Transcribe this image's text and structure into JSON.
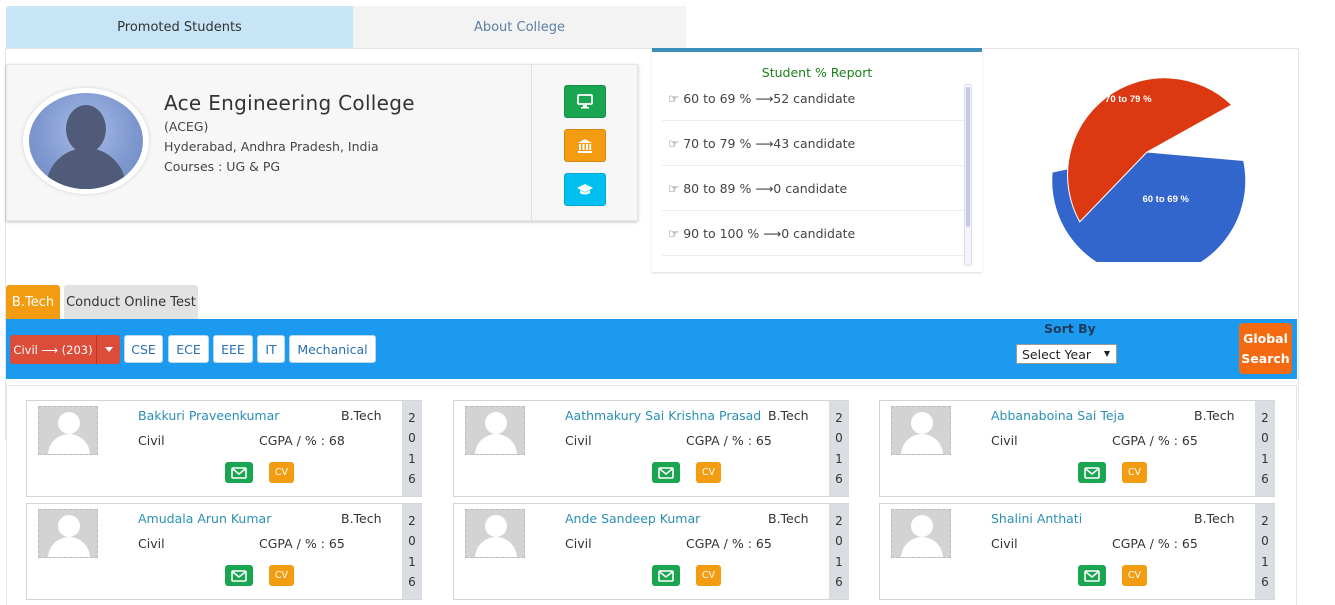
{
  "top_tabs": {
    "promoted": "Promoted Students",
    "about": "About College"
  },
  "college": {
    "name": "Ace Engineering College",
    "short": "(ACEG)",
    "location": "Hyderabad, Andhra Pradesh, India",
    "courses": "Courses : UG & PG"
  },
  "report": {
    "title": "Student % Report",
    "items": [
      {
        "range": "60 to 69 %",
        "count": "52 candidate"
      },
      {
        "range": "70 to 79 %",
        "count": "43 candidate"
      },
      {
        "range": "80 to 89 %",
        "count": "0 candidate"
      },
      {
        "range": "90 to 100 %",
        "count": "0 candidate"
      }
    ]
  },
  "chart_data": {
    "type": "pie",
    "categories": [
      "60 to 69 %",
      "70 to 79 %"
    ],
    "values": [
      52,
      43
    ],
    "colors": [
      "#3366cc",
      "#dc3912"
    ]
  },
  "course_tabs": {
    "btech": "B.Tech",
    "test": "Conduct Online Test"
  },
  "filter_bar": {
    "civil": "Civil ⟶ (203)",
    "depts": [
      "CSE",
      "ECE",
      "EEE",
      "IT",
      "Mechanical"
    ],
    "sort_label": "Sort By",
    "select_year": "Select Year",
    "global_1": "Global",
    "global_2": "Search"
  },
  "students": [
    {
      "name": "Bakkuri Praveenkumar",
      "course": "B.Tech",
      "branch": "Civil",
      "cgpa": "CGPA / % : 68",
      "cv": "CV",
      "year": [
        "2",
        "0",
        "1",
        "6"
      ]
    },
    {
      "name": "Aathmakury Sai Krishna Prasad",
      "course": "B.Tech",
      "branch": "Civil",
      "cgpa": "CGPA / % : 65",
      "cv": "CV",
      "year": [
        "2",
        "0",
        "1",
        "6"
      ]
    },
    {
      "name": "Abbanaboina Sai Teja",
      "course": "B.Tech",
      "branch": "Civil",
      "cgpa": "CGPA / % : 65",
      "cv": "CV",
      "year": [
        "2",
        "0",
        "1",
        "6"
      ]
    },
    {
      "name": "Amudala Arun Kumar",
      "course": "B.Tech",
      "branch": "Civil",
      "cgpa": "CGPA / % : 65",
      "cv": "CV",
      "year": [
        "2",
        "0",
        "1",
        "6"
      ]
    },
    {
      "name": "Ande Sandeep Kumar",
      "course": "B.Tech",
      "branch": "Civil",
      "cgpa": "CGPA / % : 65",
      "cv": "CV",
      "year": [
        "2",
        "0",
        "1",
        "6"
      ]
    },
    {
      "name": "Shalini Anthati",
      "course": "B.Tech",
      "branch": "Civil",
      "cgpa": "CGPA / % : 65",
      "cv": "CV",
      "year": [
        "2",
        "0",
        "1",
        "6"
      ]
    }
  ]
}
